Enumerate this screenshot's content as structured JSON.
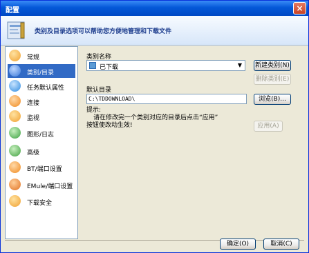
{
  "window": {
    "title": "配置",
    "close": "×"
  },
  "banner": {
    "text": "类别及目录选项可以帮助您方便地管理和下载文件"
  },
  "sidebar": {
    "items": [
      {
        "label": "常规",
        "icon": "person-icon",
        "color": "#f0a030"
      },
      {
        "label": "类别/目录",
        "icon": "folder-icon",
        "color": "#3a78d8",
        "selected": true
      },
      {
        "label": "任务默认属性",
        "icon": "gear-icon",
        "color": "#2e8be0"
      },
      {
        "label": "连接",
        "icon": "connection-icon",
        "color": "#f08a20"
      },
      {
        "label": "监视",
        "icon": "monitor-icon",
        "color": "#f0a030"
      },
      {
        "label": "图形/日志",
        "icon": "chart-icon",
        "color": "#3aa040"
      },
      {
        "label": "高级",
        "icon": "advanced-icon",
        "color": "#40a040"
      },
      {
        "label": "BT/端口设置",
        "icon": "bt-icon",
        "color": "#f08a20"
      },
      {
        "label": "EMule/端口设置",
        "icon": "emule-icon",
        "color": "#e07020"
      },
      {
        "label": "下载安全",
        "icon": "shield-icon",
        "color": "#f0a030"
      }
    ]
  },
  "category": {
    "label": "类别名称",
    "value": "已下载",
    "new_button": "新建类别(N)",
    "delete_button": "删除类别(E)"
  },
  "directory": {
    "label": "默认目录",
    "value": "C:\\TDDOWNLOAD\\",
    "browse_button": "浏览(B)..."
  },
  "hint": {
    "title": "提示:",
    "line1": "请在修改完一个类别对应的目录后点击“应用”",
    "line2": "按钮使改动生效!"
  },
  "apply_button": "应用(A)",
  "footer": {
    "ok": "确定(O)",
    "cancel": "取消(C)"
  }
}
